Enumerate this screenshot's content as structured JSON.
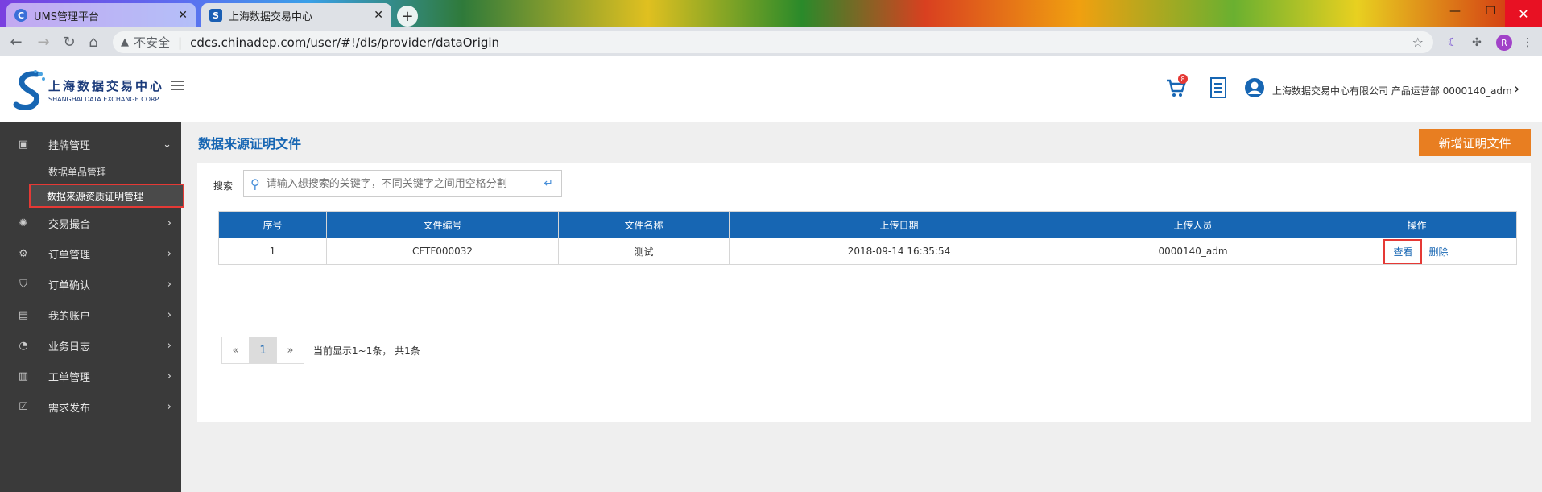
{
  "browser": {
    "tabs": [
      {
        "title": "UMS管理平台",
        "active": false
      },
      {
        "title": "上海数据交易中心",
        "active": true
      }
    ],
    "security_label": "不安全",
    "url": "cdcs.chinadep.com/user/#!/dls/provider/dataOrigin",
    "profile_initial": "R"
  },
  "header": {
    "logo_cn": "上海数据交易中心",
    "logo_en": "SHANGHAI DATA EXCHANGE CORP.",
    "cart_count": "8",
    "user_info": "上海数据交易中心有限公司 产品运营部 0000140_adm"
  },
  "sidebar": {
    "items": [
      {
        "label": "挂牌管理",
        "icon": "id-card-icon",
        "expanded": true,
        "children": [
          {
            "label": "数据单品管理",
            "active": false
          },
          {
            "label": "数据来源资质证明管理",
            "active": true
          }
        ]
      },
      {
        "label": "交易撮合",
        "icon": "handshake-icon"
      },
      {
        "label": "订单管理",
        "icon": "gear-icon"
      },
      {
        "label": "订单确认",
        "icon": "stamp-icon"
      },
      {
        "label": "我的账户",
        "icon": "account-icon"
      },
      {
        "label": "业务日志",
        "icon": "chart-pie-icon"
      },
      {
        "label": "工单管理",
        "icon": "document-icon"
      },
      {
        "label": "需求发布",
        "icon": "checkbox-icon"
      }
    ]
  },
  "main": {
    "title": "数据来源证明文件",
    "add_button": "新增证明文件",
    "search": {
      "label": "搜索",
      "placeholder": "请输入想搜索的关键字，不同关键字之间用空格分割"
    },
    "table": {
      "columns": [
        "序号",
        "文件编号",
        "文件名称",
        "上传日期",
        "上传人员",
        "操作"
      ],
      "rows": [
        {
          "index": "1",
          "file_no": "CFTF000032",
          "file_name": "测试",
          "upload_date": "2018-09-14 16:35:54",
          "uploader": "0000140_adm",
          "view": "查看",
          "delete": "删除"
        }
      ]
    },
    "pagination": {
      "prev": "«",
      "current": "1",
      "next": "»",
      "info": "当前显示1~1条， 共1条"
    }
  }
}
